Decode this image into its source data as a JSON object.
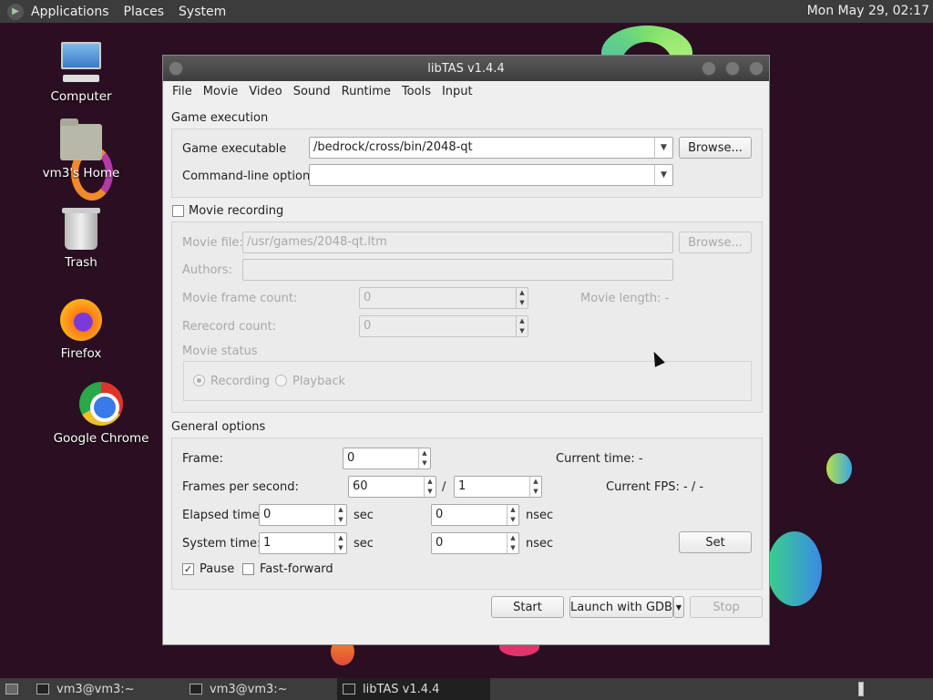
{
  "top_panel": {
    "menus": [
      "Applications",
      "Places",
      "System"
    ],
    "clock": "Mon May 29, 02:17"
  },
  "desktop_icons": [
    {
      "label": "Computer",
      "icon": "computer-icon"
    },
    {
      "label": "vm3's Home",
      "icon": "home-folder-icon"
    },
    {
      "label": "Trash",
      "icon": "trash-icon"
    },
    {
      "label": "Firefox",
      "icon": "firefox-icon"
    },
    {
      "label": "Google Chrome",
      "icon": "chrome-icon"
    }
  ],
  "window": {
    "title": "libTAS v1.4.4",
    "menu": [
      "File",
      "Movie",
      "Video",
      "Sound",
      "Runtime",
      "Tools",
      "Input"
    ],
    "game_execution": {
      "label": "Game execution",
      "executable_label": "Game executable",
      "executable_value": "/bedrock/cross/bin/2048-qt",
      "browse": "Browse...",
      "cmdline_label": "Command-line options",
      "cmdline_value": ""
    },
    "movie_recording": {
      "label": "Movie recording",
      "checked": false,
      "file_label": "Movie file:",
      "file_value": "/usr/games/2048-qt.ltm",
      "browse": "Browse...",
      "authors_label": "Authors:",
      "authors_value": "",
      "frame_count_label": "Movie frame count:",
      "frame_count_value": "0",
      "length_label": "Movie length: -",
      "rerecord_label": "Rerecord count:",
      "rerecord_value": "0",
      "status_label": "Movie status",
      "recording": "Recording",
      "playback": "Playback"
    },
    "general": {
      "label": "General options",
      "frame_label": "Frame:",
      "frame_value": "0",
      "current_time": "Current time: -",
      "fps_label": "Frames per second:",
      "fps_num": "60",
      "fps_sep": "/",
      "fps_den": "1",
      "current_fps": "Current FPS: - / -",
      "elapsed_label": "Elapsed time:",
      "elapsed_sec": "0",
      "elapsed_nsec": "0",
      "system_label": "System time:",
      "system_sec": "1",
      "system_nsec": "0",
      "sec": "sec",
      "nsec": "nsec",
      "set": "Set",
      "pause": "Pause",
      "pause_checked": true,
      "fastforward": "Fast-forward",
      "fastforward_checked": false
    },
    "buttons": {
      "start": "Start",
      "launch_gdb": "Launch with GDB",
      "stop": "Stop"
    }
  },
  "taskbar": {
    "tasks": [
      "vm3@vm3:~",
      "vm3@vm3:~",
      "libTAS v1.4.4"
    ]
  }
}
